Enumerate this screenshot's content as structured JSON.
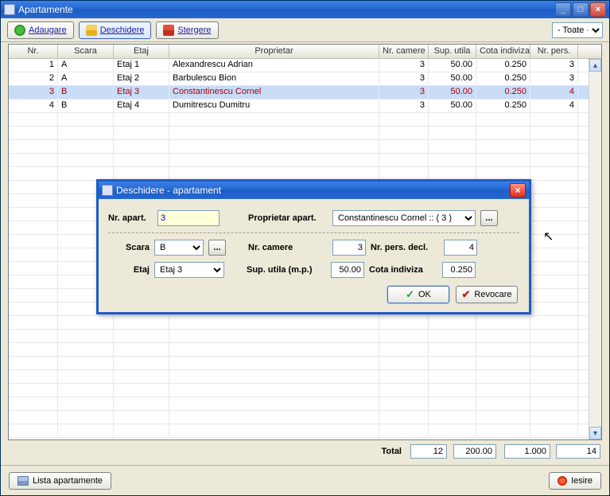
{
  "window": {
    "title": "Apartamente"
  },
  "toolbar": {
    "add": "Adaugare",
    "open": "Deschidere",
    "delete": "Stergere",
    "filter": "- Toate -"
  },
  "columns": {
    "nr": "Nr.",
    "scara": "Scara",
    "etaj": "Etaj",
    "proprietar": "Proprietar",
    "camere": "Nr. camere",
    "sup": "Sup. utila",
    "cota": "Cota indiviza",
    "pers": "Nr. pers."
  },
  "rows": [
    {
      "nr": "1",
      "scara": "A",
      "etaj": "Etaj 1",
      "prop": "Alexandrescu Adrian",
      "cam": "3",
      "sup": "50.00",
      "cota": "0.250",
      "pers": "3"
    },
    {
      "nr": "2",
      "scara": "A",
      "etaj": "Etaj 2",
      "prop": "Barbulescu Bion",
      "cam": "3",
      "sup": "50.00",
      "cota": "0.250",
      "pers": "3"
    },
    {
      "nr": "3",
      "scara": "B",
      "etaj": "Etaj 3",
      "prop": "Constantinescu Cornel",
      "cam": "3",
      "sup": "50.00",
      "cota": "0.250",
      "pers": "4"
    },
    {
      "nr": "4",
      "scara": "B",
      "etaj": "Etaj 4",
      "prop": "Dumitrescu Dumitru",
      "cam": "3",
      "sup": "50.00",
      "cota": "0.250",
      "pers": "4"
    }
  ],
  "totals": {
    "label": "Total",
    "cam": "12",
    "sup": "200.00",
    "cota": "1.000",
    "pers": "14"
  },
  "bottom": {
    "list": "Lista apartamente",
    "exit": "Iesire"
  },
  "dialog": {
    "title": "Deschidere - apartament",
    "labels": {
      "nr": "Nr. apart.",
      "prop": "Proprietar apart.",
      "scara": "Scara",
      "etaj": "Etaj",
      "cam": "Nr. camere",
      "sup": "Sup. utila (m.p.)",
      "pers": "Nr. pers. decl.",
      "cota": "Cota indiviza"
    },
    "values": {
      "nr": "3",
      "prop": "Constantinescu Cornel :: ( 3 )",
      "scara": "B",
      "etaj": "Etaj 3",
      "cam": "3",
      "sup": "50.00",
      "pers": "4",
      "cota": "0.250"
    },
    "buttons": {
      "ok": "OK",
      "cancel": "Revocare",
      "dots": "..."
    }
  }
}
